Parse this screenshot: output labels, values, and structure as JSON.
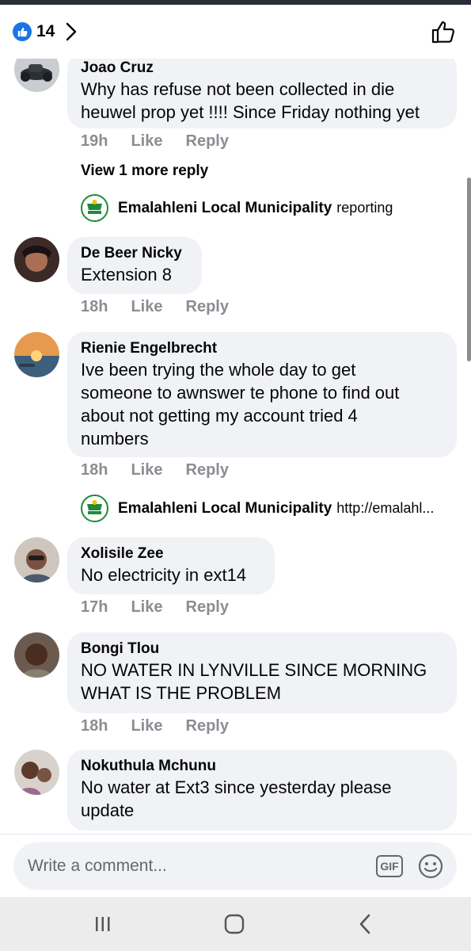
{
  "header": {
    "like_count": "14",
    "icons": [
      "like-badge-icon",
      "chevron-right-icon",
      "thumbs-up-outline-icon"
    ]
  },
  "comments": [
    {
      "author": "Joao Cruz",
      "text_lines": [
        "Why has refuse not been collected in die",
        "heuwel prop yet !!!! Since Friday nothing yet"
      ],
      "time": "19h",
      "like": "Like",
      "reply": "Reply",
      "more_replies": "View 1 more reply",
      "page_reply": {
        "author": "Emalahleni Local Municipality",
        "text": "reporting"
      }
    },
    {
      "author": "De Beer Nicky",
      "text_lines": [
        "Extension 8"
      ],
      "time": "18h",
      "like": "Like",
      "reply": "Reply"
    },
    {
      "author": "Rienie Engelbrecht",
      "text_lines": [
        "Ive been trying the whole day to get",
        "someone to awnswer te phone to find out",
        "about not getting my account tried 4",
        "numbers"
      ],
      "time": "18h",
      "like": "Like",
      "reply": "Reply",
      "page_reply": {
        "author": "Emalahleni Local Municipality",
        "text": "http://emalahl..."
      }
    },
    {
      "author": "Xolisile Zee",
      "text_lines": [
        "No electricity in ext14"
      ],
      "time": "17h",
      "like": "Like",
      "reply": "Reply"
    },
    {
      "author": "Bongi Tlou",
      "text_lines": [
        "NO WATER IN LYNVILLE SINCE MORNING",
        "WHAT IS THE PROBLEM"
      ],
      "time": "18h",
      "like": "Like",
      "reply": "Reply"
    },
    {
      "author": "Nokuthula Mchunu",
      "text_lines": [
        "No water  at Ext3 since yesterday  please",
        "update"
      ]
    }
  ],
  "composer": {
    "placeholder": "Write a comment...",
    "gif_label": "GIF"
  },
  "navbar": {
    "icons": [
      "recent-apps-icon",
      "home-icon",
      "back-icon"
    ]
  },
  "colors": {
    "accent": "#1b74e4",
    "bubble": "#f0f2f5",
    "muted": "#8a8d91",
    "municipality_green": "#1f8a3a"
  }
}
